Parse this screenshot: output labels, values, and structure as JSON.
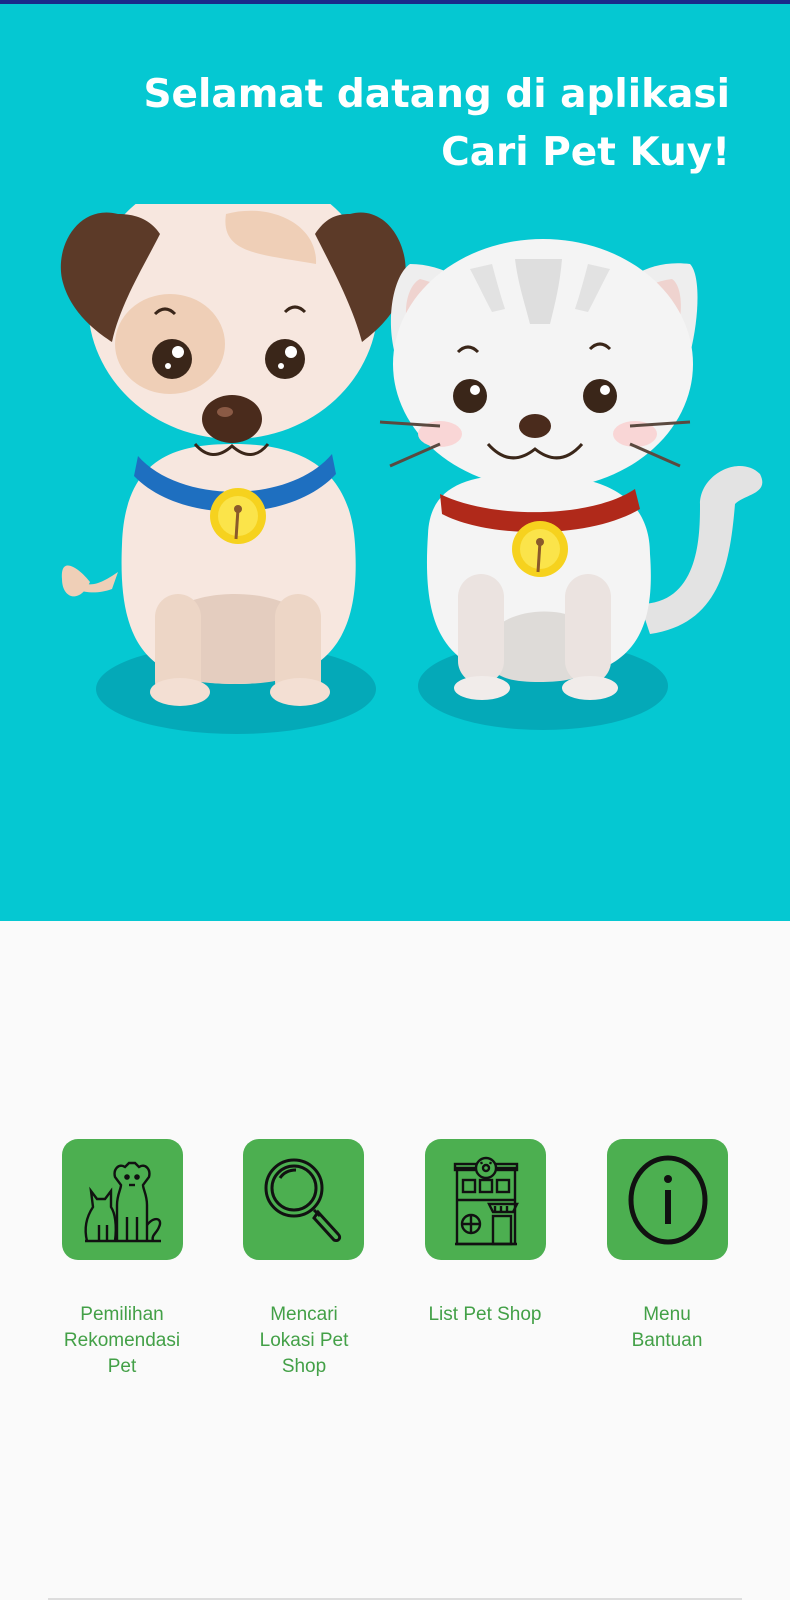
{
  "app": {
    "welcome_line1": "Selamat datang di aplikasi",
    "welcome_line2": "Cari Pet Kuy!"
  },
  "colors": {
    "hero_bg": "#05c8d2",
    "tile_bg": "#4caf50",
    "label_color": "#43a047"
  },
  "menu": {
    "items": [
      {
        "icon": "dog-cat-icon",
        "label_lines": [
          "Pemilihan",
          "Rekomendasi",
          "Pet"
        ]
      },
      {
        "icon": "magnifier-icon",
        "label_lines": [
          "Mencari",
          "Lokasi Pet",
          "Shop"
        ]
      },
      {
        "icon": "pet-shop-building-icon",
        "label_lines": [
          "List Pet Shop"
        ]
      },
      {
        "icon": "info-icon",
        "label_lines": [
          "Menu",
          "Bantuan"
        ]
      }
    ]
  }
}
